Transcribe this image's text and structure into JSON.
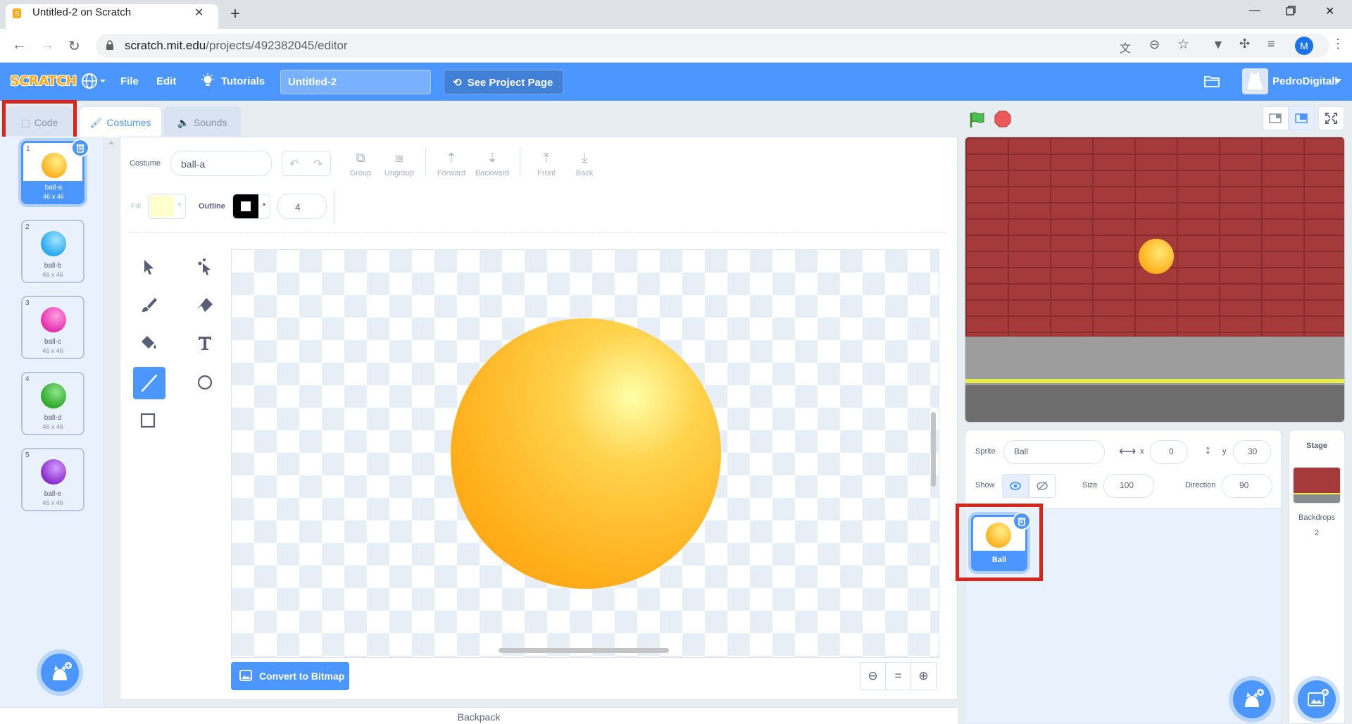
{
  "browser": {
    "tab_title": "Untitled-2 on Scratch",
    "new_tab_label": "+",
    "url_host": "scratch.mit.edu",
    "url_path": "/projects/492382045/editor",
    "profile_initial": "M"
  },
  "menu": {
    "logo": "SCRATCH",
    "file": "File",
    "edit": "Edit",
    "tutorials": "Tutorials",
    "project_title": "Untitled-2",
    "see_project_page": "See Project Page",
    "username": "PedroDigitall"
  },
  "editor_tabs": {
    "code": "Code",
    "costumes": "Costumes",
    "sounds": "Sounds"
  },
  "costumes": [
    {
      "num": "1",
      "name": "ball-a",
      "size": "46 x 46",
      "color": "#ffc326"
    },
    {
      "num": "2",
      "name": "ball-b",
      "size": "46 x 46",
      "color": "#38b8f2"
    },
    {
      "num": "3",
      "name": "ball-c",
      "size": "46 x 46",
      "color": "#f03cb4"
    },
    {
      "num": "4",
      "name": "ball-d",
      "size": "46 x 46",
      "color": "#3db83a"
    },
    {
      "num": "5",
      "name": "ball-e",
      "size": "46 x 46",
      "color": "#9b3ad6"
    }
  ],
  "paint": {
    "costume_label": "Costume",
    "costume_name": "ball-a",
    "group": "Group",
    "ungroup": "Ungroup",
    "forward": "Forward",
    "backward": "Backward",
    "front": "Front",
    "back": "Back",
    "fill_label": "Fill",
    "outline_label": "Outline",
    "outline_width": "4",
    "fill_color": "#ffffcc",
    "convert": "Convert to Bitmap",
    "zoom_reset": "="
  },
  "backpack": "Backpack",
  "sprite": {
    "sprite_label": "Sprite",
    "name": "Ball",
    "x_label": "x",
    "x": "0",
    "y_label": "y",
    "y": "30",
    "show_label": "Show",
    "size_label": "Size",
    "size": "100",
    "direction_label": "Direction",
    "direction": "90",
    "tile_name": "Ball"
  },
  "stage_pane": {
    "title": "Stage",
    "backdrops_label": "Backdrops",
    "backdrops_count": "2"
  },
  "colors": {
    "scratch_blue": "#4c97ff",
    "highlight_red": "#d9261c"
  }
}
